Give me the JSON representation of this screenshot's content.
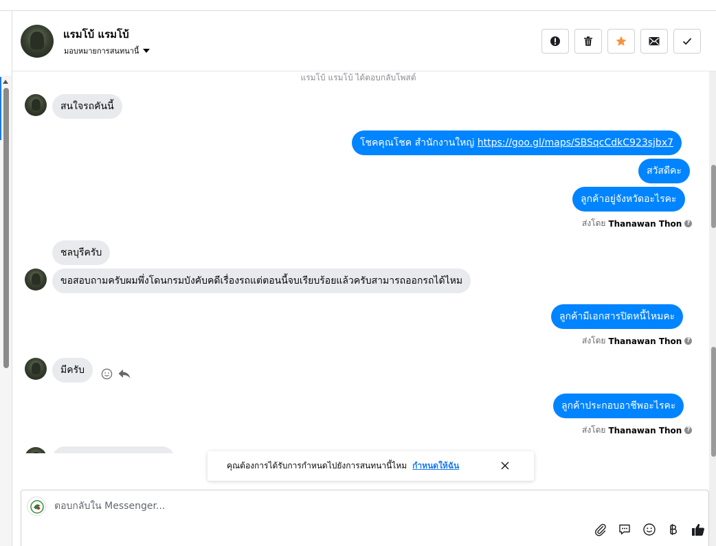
{
  "header": {
    "name": "แรมโบ้ แรมโบ้",
    "assign_label": "มอบหมายการสนทนานี้",
    "buttons": [
      {
        "icon": "alert-icon"
      },
      {
        "icon": "trash-icon"
      },
      {
        "icon": "star-icon",
        "color": "#f7923b"
      },
      {
        "icon": "mail-icon"
      },
      {
        "icon": "check-icon"
      }
    ]
  },
  "chat": {
    "system_note": "แรมโบ้ แรมโบ้ ได้ตอบกลับโพสต์",
    "messages": {
      "m1": "สนใจรถคันนี้",
      "m2_text": "โชคคุณโชค สำนักงานใหญ่ ",
      "m2_link": "https://goo.gl/maps/SBSqcCdkC923sjbx7",
      "m3": "สวัสดีคะ",
      "m4": "ลูกค้าอยู่จังหวัดอะไรคะ",
      "m5": "ชลบุรีครับ",
      "m6": "ขอสอบถามครับผมพึ่งโดนกรมบังคับคดีเรื่องรถแต่ตอนนี้จบเรียบร้อยแล้วครับสามารถออกรถได้ไหม",
      "m7": "ลูกค้ามีเอกสารปิดหนี้ไหมคะ",
      "m8": "มีครับ",
      "m9": "ลูกค้าประกอบอาชีพอะไรคะ"
    },
    "sent_by_label": "ส่งโดย",
    "sent_by_name": "Thanawan Thon",
    "outgoing_color": "#0084ff",
    "incoming_color": "#e9eaed"
  },
  "banner": {
    "text": "คุณต้องการได้รับการกำหนดไปยังการสนทนานี้ไหม",
    "link": "กำหนดให้ฉัน"
  },
  "composer": {
    "placeholder": "ตอบกลับใน Messenger...",
    "tools": [
      "paperclip-icon",
      "quick-reply-icon",
      "emoji-icon",
      "baht-icon",
      "thumbs-up-icon"
    ]
  }
}
